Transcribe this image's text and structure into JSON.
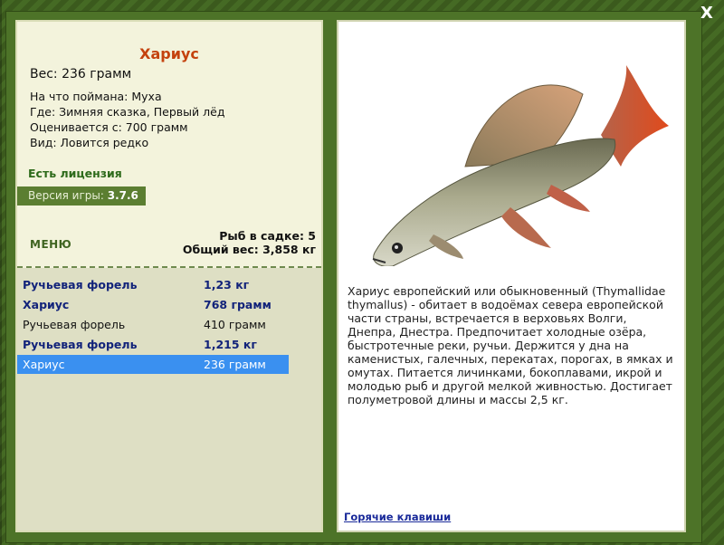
{
  "close_label": "X",
  "fish": {
    "title": "Хариус",
    "weight": "Вес: 236 грамм",
    "caught_on": "На что поймана: Муха",
    "location": "Где: Зимняя сказка, Первый лёд",
    "valued_from": "Оценивается с: 700 грамм",
    "rarity": "Вид: Ловится редко"
  },
  "license": "Есть лицензия",
  "version": {
    "label": "Версия игры:",
    "value": "3.7.6"
  },
  "menu_label": "МЕНЮ",
  "cage": {
    "count": "Рыб в садке: 5",
    "total": "Общий вес: 3,858 кг"
  },
  "catch_list": [
    {
      "name": "Ручьевая форель",
      "weight": "1,23 кг",
      "style": "bold"
    },
    {
      "name": "Хариус",
      "weight": "768 грамм",
      "style": "bold"
    },
    {
      "name": "Ручьевая форель",
      "weight": "410 грамм",
      "style": "plain"
    },
    {
      "name": "Ручьевая форель",
      "weight": "1,215 кг",
      "style": "bold"
    },
    {
      "name": "Хариус",
      "weight": "236 грамм",
      "style": "selected"
    }
  ],
  "description": "Хариус европейский или обыкновенный (Thymallidae thymallus) - обитает в водоёмах севера европейской части страны, встречается в верховьях Волги, Днепра, Днестра. Предпочитает холодные озёра, быстротечные реки, ручьи. Держится у дна на каменистых, галечных, перекатах, порогах, в ямках и омутах. Питается личинками, бокоплавами, икрой и молодью рыб и другой мелкой живностью. Достигает полуметровой длины и массы 2,5 кг.",
  "hotkeys_label": "Горячие клавиши",
  "colors": {
    "accent_title": "#c4420e",
    "selected_row": "#3a90f0",
    "list_bold": "#12237a"
  }
}
